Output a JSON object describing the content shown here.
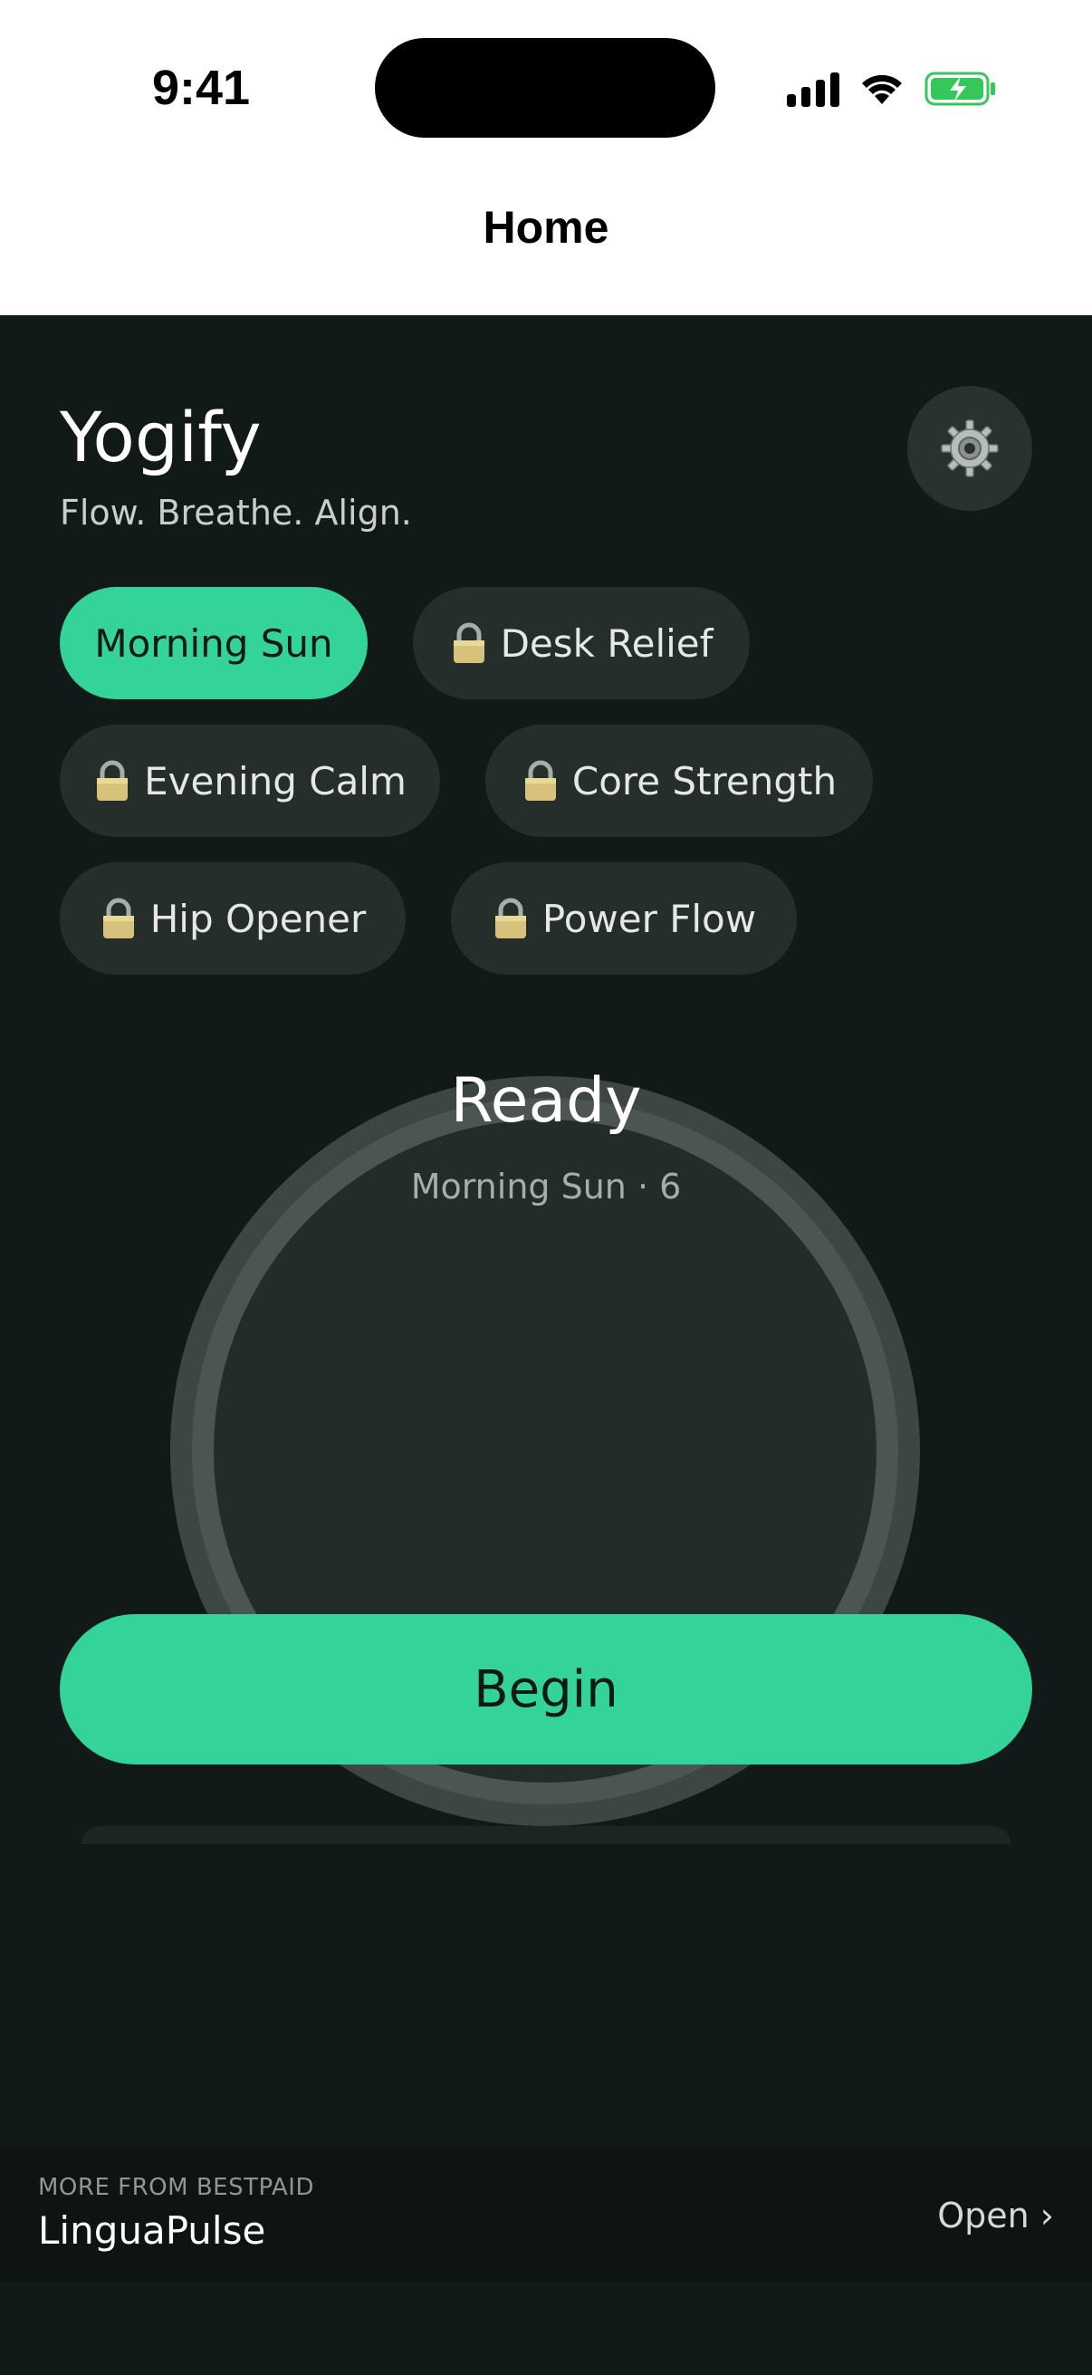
{
  "status_bar": {
    "time": "9:41"
  },
  "nav": {
    "title": "Home"
  },
  "app": {
    "title": "Yogify",
    "tagline": "Flow. Breathe. Align."
  },
  "icons": {
    "settings": "gear-icon",
    "lock": "lock-icon"
  },
  "colors": {
    "accent": "#34d399",
    "background": "#111a18",
    "chip": "#262e2c"
  },
  "routines": [
    {
      "label": "Morning Sun",
      "locked": false,
      "selected": true
    },
    {
      "label": "Desk Relief",
      "locked": true,
      "selected": false
    },
    {
      "label": "Evening Calm",
      "locked": true,
      "selected": false
    },
    {
      "label": "Core Strength",
      "locked": true,
      "selected": false
    },
    {
      "label": "Hip Opener",
      "locked": true,
      "selected": false
    },
    {
      "label": "Power Flow",
      "locked": true,
      "selected": false
    }
  ],
  "session": {
    "status": "Ready",
    "detail": "Morning Sun · 6"
  },
  "actions": {
    "begin_label": "Begin"
  },
  "promo": {
    "label": "MORE FROM BESTPAID",
    "name": "LinguaPulse",
    "open_label": "Open ›"
  }
}
